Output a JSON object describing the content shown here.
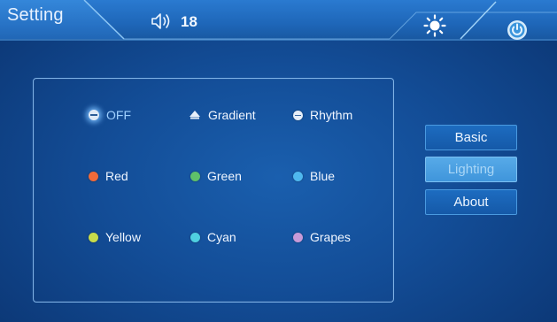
{
  "header": {
    "title": "Setting",
    "volume_value": "18",
    "icons": [
      "speaker-icon",
      "sun-icon",
      "power-icon"
    ]
  },
  "options": [
    {
      "label": "OFF",
      "icon": "off-dot-icon",
      "color": "#dfe9f6",
      "selected": true
    },
    {
      "label": "Gradient",
      "icon": "gradient-icon",
      "color": "#dfe9f6",
      "selected": false
    },
    {
      "label": "Rhythm",
      "icon": "rhythm-icon",
      "color": "#e6eef8",
      "selected": false
    },
    {
      "label": "Red",
      "icon": "red-dot-icon",
      "color": "#f06a3a",
      "selected": false
    },
    {
      "label": "Green",
      "icon": "green-dot-icon",
      "color": "#5fc06a",
      "selected": false
    },
    {
      "label": "Blue",
      "icon": "blue-dot-icon",
      "color": "#4fb8ee",
      "selected": false
    },
    {
      "label": "Yellow",
      "icon": "yellow-dot-icon",
      "color": "#c8dc4a",
      "selected": false
    },
    {
      "label": "Cyan",
      "icon": "cyan-dot-icon",
      "color": "#4fd0e0",
      "selected": false
    },
    {
      "label": "Grapes",
      "icon": "grapes-dot-icon",
      "color": "#c79ad8",
      "selected": false
    }
  ],
  "sidebar": {
    "buttons": [
      {
        "label": "Basic",
        "active": false
      },
      {
        "label": "Lighting",
        "active": true
      },
      {
        "label": "About",
        "active": false
      }
    ]
  },
  "colors": {
    "background": "#134d97",
    "topbar": "#1e66b8",
    "active_button": "#4fa0e2"
  }
}
